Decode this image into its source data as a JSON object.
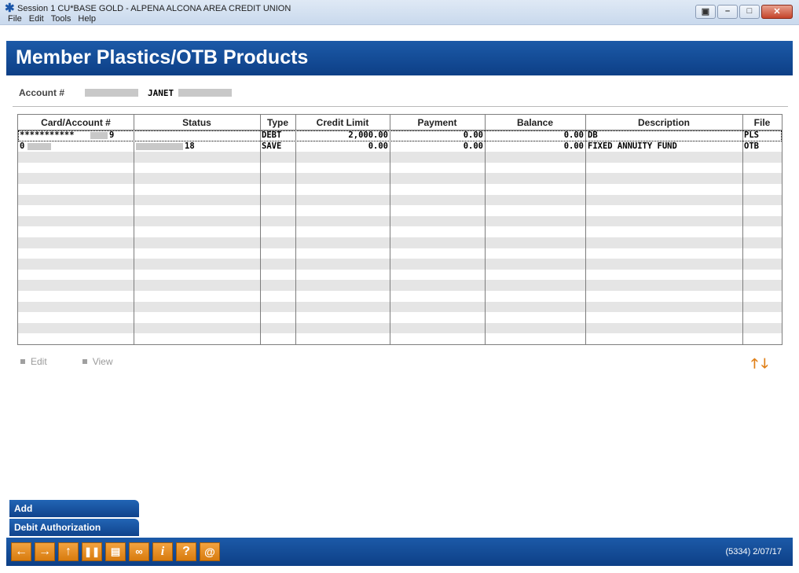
{
  "window": {
    "title": "Session 1 CU*BASE GOLD - ALPENA ALCONA AREA CREDIT UNION",
    "menu": [
      "File",
      "Edit",
      "Tools",
      "Help"
    ]
  },
  "page": {
    "title": "Member Plastics/OTB Products"
  },
  "account": {
    "label": "Account #",
    "member_name": "JANET"
  },
  "table": {
    "columns": [
      "Card/Account #",
      "Status",
      "Type",
      "Credit Limit",
      "Payment",
      "Balance",
      "Description",
      "File"
    ],
    "rows": [
      {
        "card": "***********",
        "card_suffix": "9",
        "status": "",
        "type": "DEBT",
        "credit_limit": "2,000.00",
        "payment": "0.00",
        "balance": "0.00",
        "description": "DB",
        "file": "PLS"
      },
      {
        "card": "0",
        "card_suffix": "",
        "status": "18",
        "type": "SAVE",
        "credit_limit": "0.00",
        "payment": "0.00",
        "balance": "0.00",
        "description": "FIXED ANNUITY FUND",
        "file": "OTB"
      }
    ],
    "empty_rows": 18
  },
  "actions": {
    "edit": "Edit",
    "view": "View"
  },
  "side_buttons": {
    "add": "Add",
    "debit": "Debit Authorization"
  },
  "footer": {
    "status": "(5334) 2/07/17",
    "keys": [
      "arrow-left-icon",
      "arrow-right-icon",
      "arrow-up-icon",
      "pause-icon",
      "print-icon",
      "link-icon",
      "info-icon",
      "help-icon",
      "at-icon"
    ]
  },
  "colors": {
    "header_blue": "#0d3f86",
    "accent_orange": "#e07f16",
    "row_alt": "#e5e5e5"
  }
}
